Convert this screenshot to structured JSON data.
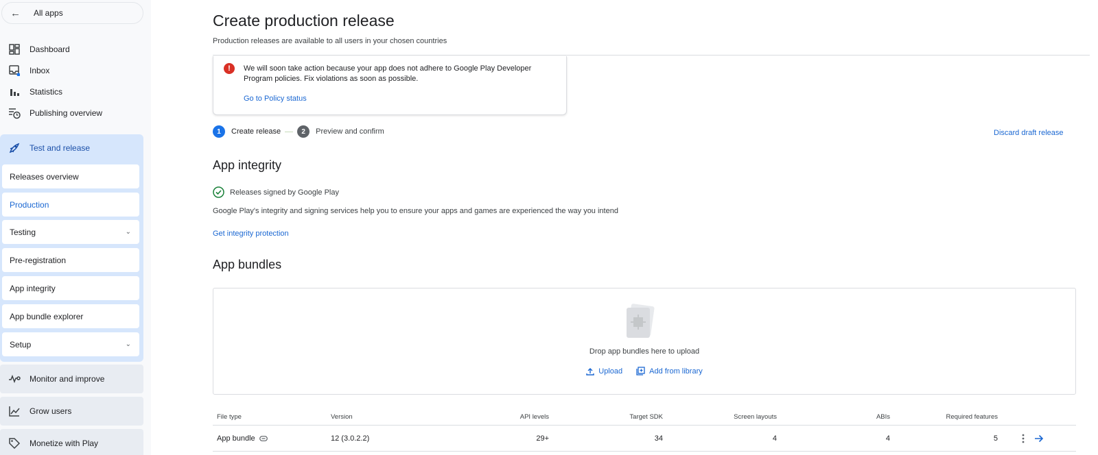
{
  "sidebar": {
    "back_label": "All apps",
    "items": [
      {
        "label": "Dashboard",
        "icon": "dashboard-icon"
      },
      {
        "label": "Inbox",
        "icon": "inbox-icon"
      },
      {
        "label": "Statistics",
        "icon": "bar-chart-icon"
      },
      {
        "label": "Publishing overview",
        "icon": "publishing-icon"
      }
    ],
    "group": {
      "label": "Test and release",
      "subitems": [
        {
          "label": "Releases overview"
        },
        {
          "label": "Production"
        },
        {
          "label": "Testing"
        },
        {
          "label": "Pre-registration"
        },
        {
          "label": "App integrity"
        },
        {
          "label": "App bundle explorer"
        },
        {
          "label": "Setup"
        }
      ]
    },
    "sections": [
      {
        "label": "Monitor and improve"
      },
      {
        "label": "Grow users"
      },
      {
        "label": "Monetize with Play"
      }
    ]
  },
  "page": {
    "title": "Create production release",
    "subtitle": "Production releases are available to all users in your chosen countries"
  },
  "alert": {
    "message": "We will soon take action because your app does not adhere to Google Play Developer Program policies. Fix violations as soon as possible.",
    "link": "Go to Policy status"
  },
  "stepper": {
    "step1_num": "1",
    "step1_label": "Create release",
    "step2_num": "2",
    "step2_label": "Preview and confirm"
  },
  "discard_label": "Discard draft release",
  "integrity": {
    "heading": "App integrity",
    "signed_label": "Releases signed by Google Play",
    "description": "Google Play's integrity and signing services help you to ensure your apps and games are experienced the way you intend",
    "link": "Get integrity protection"
  },
  "bundles": {
    "heading": "App bundles",
    "drop_text": "Drop app bundles here to upload",
    "upload_label": "Upload",
    "library_label": "Add from library"
  },
  "table": {
    "headers": {
      "file_type": "File type",
      "version": "Version",
      "api_levels": "API levels",
      "target_sdk": "Target SDK",
      "screen_layouts": "Screen layouts",
      "abis": "ABIs",
      "required_features": "Required features"
    },
    "rows": [
      {
        "file_type": "App bundle",
        "version": "12 (3.0.2.2)",
        "api_levels": "29+",
        "target_sdk": "34",
        "screen_layouts": "4",
        "abis": "4",
        "required_features": "5"
      }
    ]
  },
  "colors": {
    "accent": "#1a73e8",
    "link": "#1a67d2",
    "error": "#d93025",
    "success": "#188038",
    "group_bg": "#d6e6fc"
  }
}
